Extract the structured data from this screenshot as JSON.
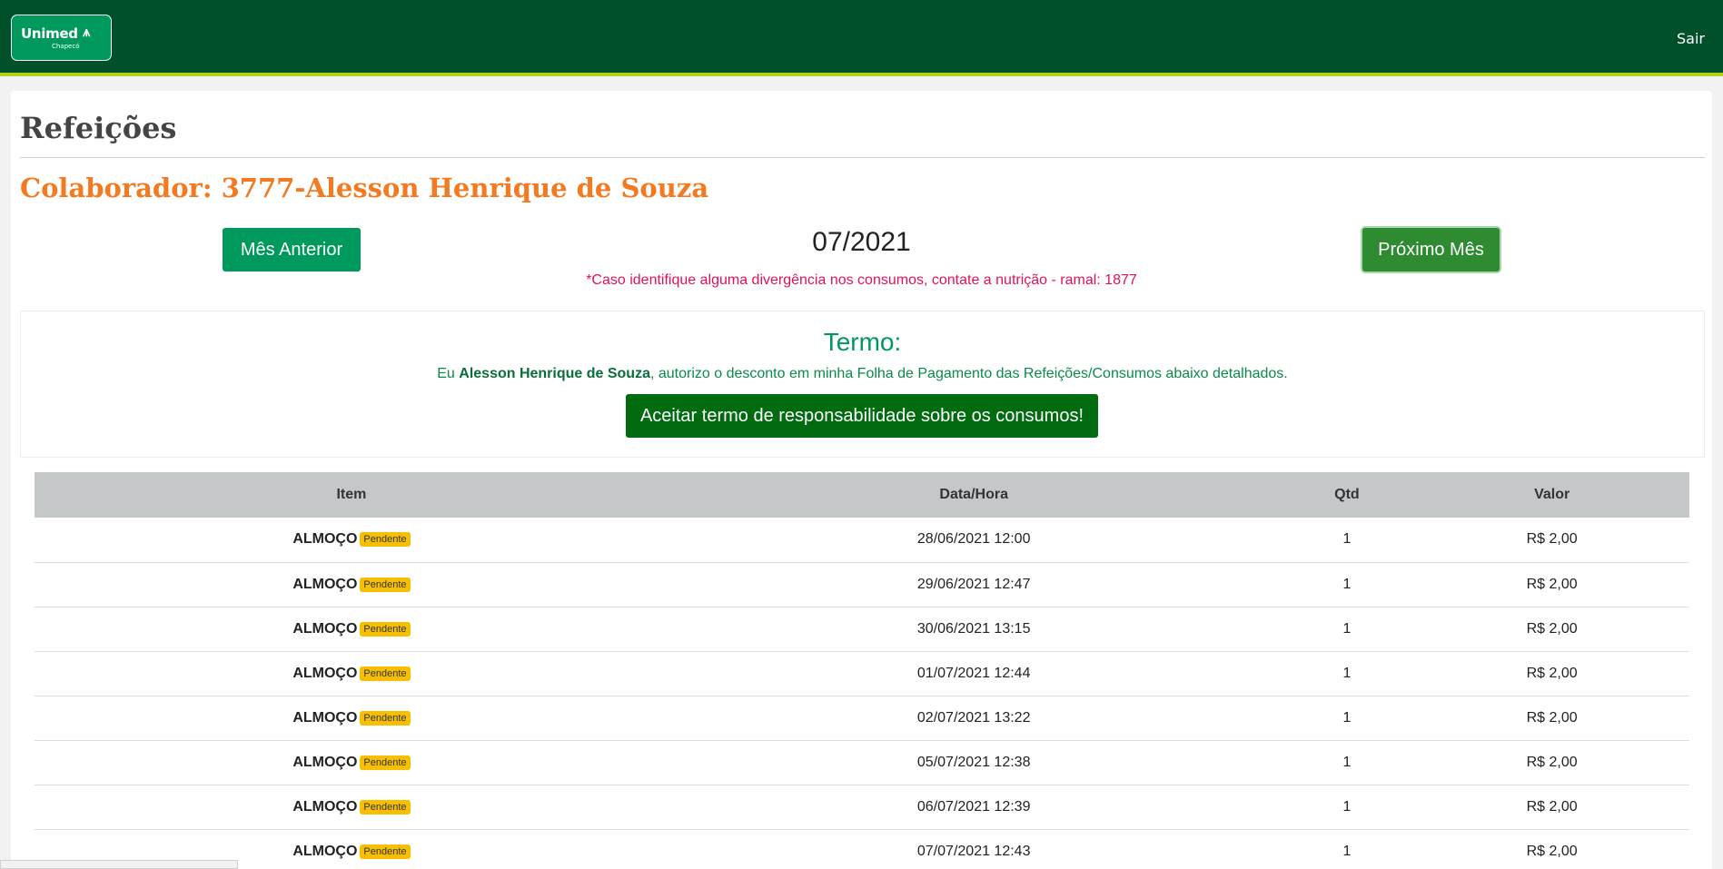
{
  "header": {
    "logo": {
      "brand": "Unimed",
      "mark": "⩚",
      "sub": "Chapecó"
    },
    "logout_label": "Sair"
  },
  "page": {
    "title": "Refeições",
    "collaborator": "Colaborador: 3777-Alesson Henrique de Souza",
    "prev_label": "Mês Anterior",
    "next_label": "Próximo Mês",
    "month": "07/2021",
    "notice": "*Caso identifique alguma divergência nos consumos, contate a nutrição - ramal: 1877"
  },
  "term": {
    "title": "Termo:",
    "text_prefix": "Eu ",
    "name": "Alesson Henrique de Souza",
    "text_suffix": ", autorizo o desconto em minha Folha de Pagamento das Refeições/Consumos abaixo detalhados.",
    "accept_label": "Aceitar termo de responsabilidade sobre os consumos!"
  },
  "table": {
    "columns": [
      "Item",
      "Data/Hora",
      "Qtd",
      "Valor"
    ],
    "rows": [
      {
        "item": "ALMOÇO",
        "status": "Pendente",
        "datetime": "28/06/2021 12:00",
        "qty": "1",
        "value": "R$ 2,00"
      },
      {
        "item": "ALMOÇO",
        "status": "Pendente",
        "datetime": "29/06/2021 12:47",
        "qty": "1",
        "value": "R$ 2,00"
      },
      {
        "item": "ALMOÇO",
        "status": "Pendente",
        "datetime": "30/06/2021 13:15",
        "qty": "1",
        "value": "R$ 2,00"
      },
      {
        "item": "ALMOÇO",
        "status": "Pendente",
        "datetime": "01/07/2021 12:44",
        "qty": "1",
        "value": "R$ 2,00"
      },
      {
        "item": "ALMOÇO",
        "status": "Pendente",
        "datetime": "02/07/2021 13:22",
        "qty": "1",
        "value": "R$ 2,00"
      },
      {
        "item": "ALMOÇO",
        "status": "Pendente",
        "datetime": "05/07/2021 12:38",
        "qty": "1",
        "value": "R$ 2,00"
      },
      {
        "item": "ALMOÇO",
        "status": "Pendente",
        "datetime": "06/07/2021 12:39",
        "qty": "1",
        "value": "R$ 2,00"
      },
      {
        "item": "ALMOÇO",
        "status": "Pendente",
        "datetime": "07/07/2021 12:43",
        "qty": "1",
        "value": "R$ 2,00"
      }
    ]
  },
  "colors": {
    "header_bg": "#00512a",
    "header_accent": "#b3cf17",
    "brand_green": "#00995d",
    "title_orange": "#f37a21",
    "notice_pink": "#e4105c",
    "badge_yellow": "#f6c000"
  }
}
